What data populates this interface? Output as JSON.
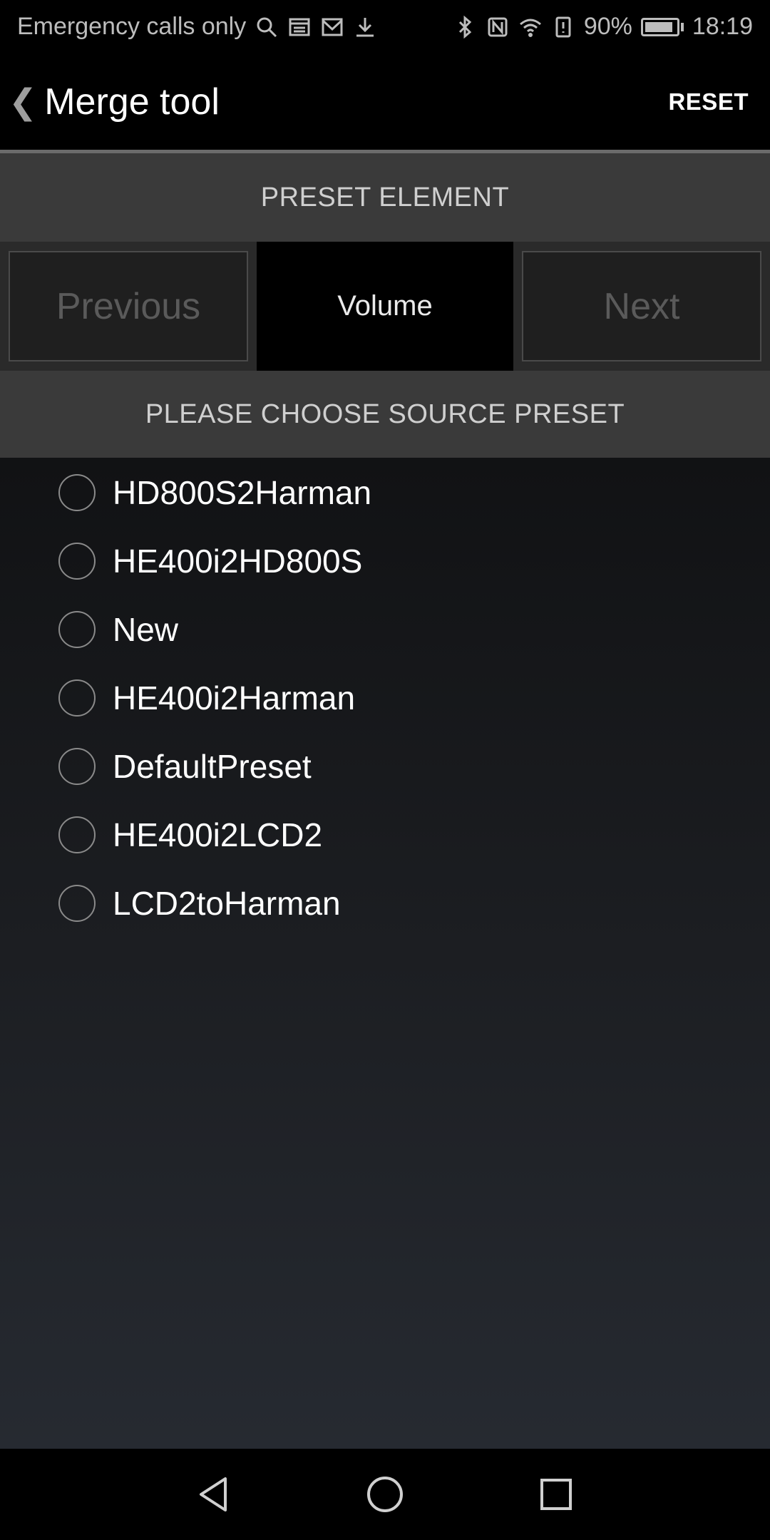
{
  "status_bar": {
    "left_text": "Emergency calls only",
    "battery_percent": "90%",
    "battery_level": 0.9,
    "time": "18:19",
    "left_icons": [
      "search-icon",
      "calendar-icon",
      "mail-icon",
      "download-icon"
    ],
    "right_icons": [
      "bluetooth-icon",
      "nfc-icon",
      "wifi-icon",
      "alert-icon",
      "battery-icon"
    ]
  },
  "app_bar": {
    "back_glyph": "❮",
    "title": "Merge tool",
    "reset_label": "RESET"
  },
  "preset_section": {
    "header": "PRESET ELEMENT",
    "previous_label": "Previous",
    "current_element": "Volume",
    "next_label": "Next"
  },
  "source_section": {
    "header": "PLEASE CHOOSE SOURCE PRESET"
  },
  "presets": [
    "HD800S2Harman",
    "HE400i2HD800S",
    "New",
    "HE400i2Harman",
    "DefaultPreset",
    "HE400i2LCD2",
    "LCD2toHarman"
  ],
  "bottom_nav": [
    "back-icon",
    "home-icon",
    "recents-icon"
  ]
}
